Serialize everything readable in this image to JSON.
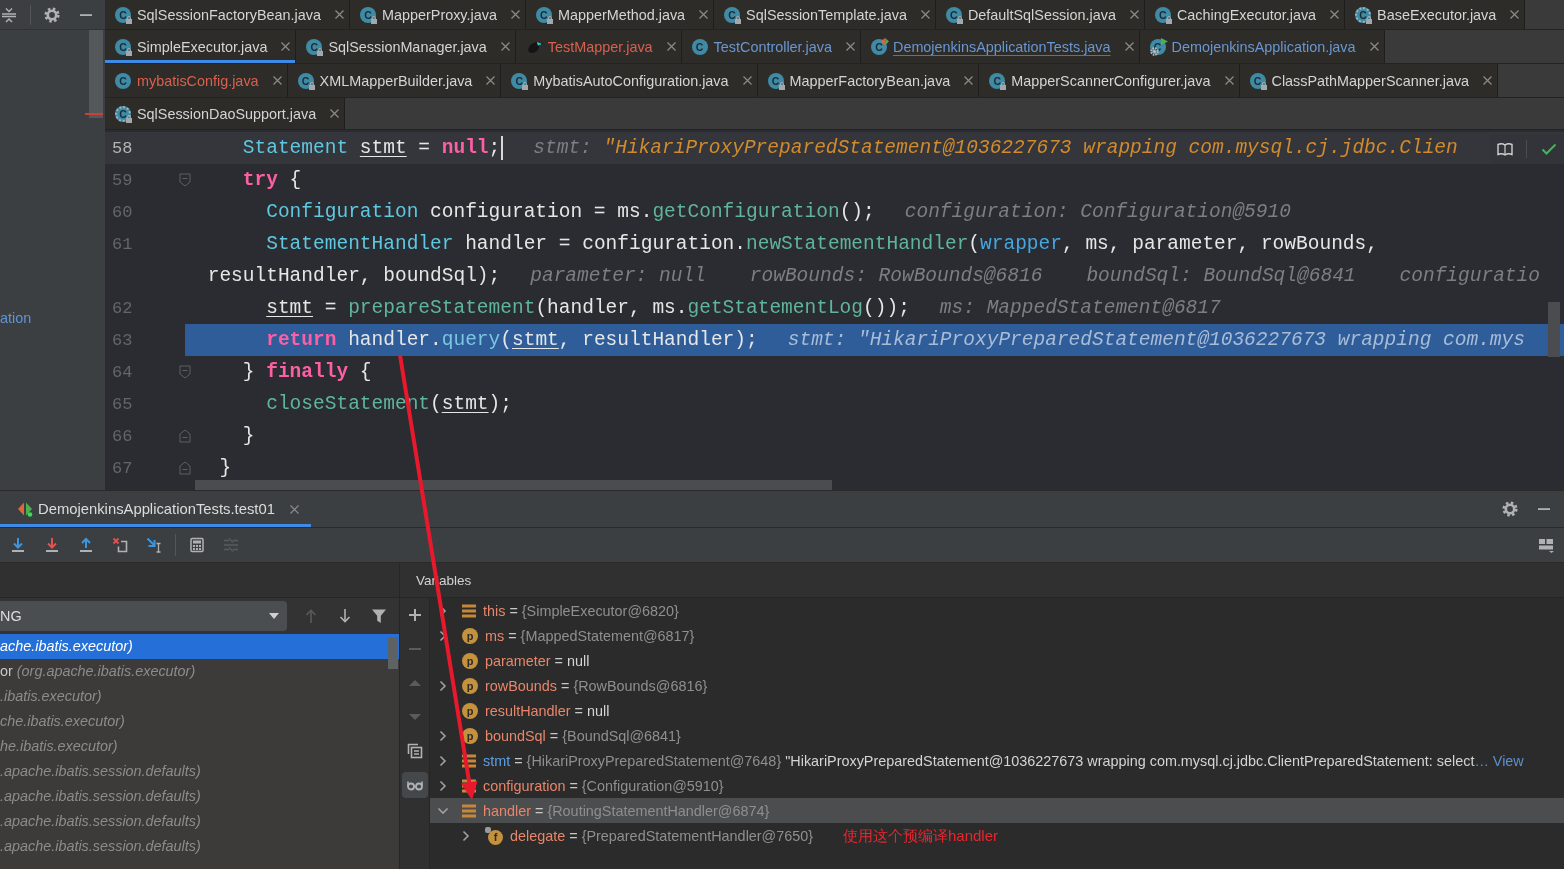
{
  "left_toolbar": [
    {
      "kind": "collapse"
    },
    {
      "kind": "settings"
    },
    {
      "kind": "minimize"
    }
  ],
  "project_panel": {
    "item": "ation"
  },
  "tab_rows": [
    [
      {
        "label": "SqlSessionFactoryBean.java",
        "kind": "class",
        "badge": "C",
        "locked": true,
        "color": "#d4d4d4",
        "selected": false,
        "errors": false
      },
      {
        "label": "MapperProxy.java",
        "kind": "class",
        "badge": "C",
        "locked": true,
        "color": "#d4d4d4",
        "selected": false,
        "errors": false
      },
      {
        "label": "MapperMethod.java",
        "kind": "class",
        "badge": "C",
        "locked": true,
        "color": "#d4d4d4",
        "selected": false,
        "errors": false
      },
      {
        "label": "SqlSessionTemplate.java",
        "kind": "class",
        "badge": "C",
        "locked": true,
        "color": "#d4d4d4",
        "selected": false,
        "errors": false
      },
      {
        "label": "DefaultSqlSession.java",
        "kind": "class",
        "badge": "C",
        "locked": true,
        "color": "#d4d4d4",
        "selected": false,
        "errors": false
      },
      {
        "label": "CachingExecutor.java",
        "kind": "class",
        "badge": "C",
        "locked": true,
        "color": "#d4d4d4",
        "selected": false,
        "errors": false
      },
      {
        "label": "BaseExecutor.java",
        "kind": "abstract",
        "badge": "C",
        "locked": true,
        "color": "#d4d4d4",
        "selected": false,
        "errors": false
      }
    ],
    [
      {
        "label": "SimpleExecutor.java",
        "kind": "class",
        "badge": "C",
        "locked": true,
        "color": "#d4d4d4",
        "selected": true,
        "errors": false
      },
      {
        "label": "SqlSessionManager.java",
        "kind": "class",
        "badge": "C",
        "locked": true,
        "color": "#d4d4d4",
        "selected": false,
        "errors": false
      },
      {
        "label": "TestMapper.java",
        "kind": "mapper",
        "locked": false,
        "color": "#d8604f",
        "selected": false,
        "errors": false
      },
      {
        "label": "TestController.java",
        "kind": "class",
        "badge": "C",
        "locked": false,
        "color": "#6897d2",
        "selected": false,
        "errors": false
      },
      {
        "label": "DemojenkinsApplicationTests.java",
        "kind": "test",
        "badge": "C",
        "locked": false,
        "color": "#6897d2",
        "selected": false,
        "errors": true
      },
      {
        "label": "DemojenkinsApplication.java",
        "kind": "app",
        "badge": "C",
        "locked": false,
        "color": "#6897d2",
        "selected": false,
        "errors": false
      }
    ],
    [
      {
        "label": "mybatisConfig.java",
        "kind": "class",
        "badge": "C",
        "locked": false,
        "color": "#d8604f",
        "selected": false,
        "errors": false
      },
      {
        "label": "XMLMapperBuilder.java",
        "kind": "class",
        "badge": "C",
        "locked": true,
        "color": "#d4d4d4",
        "selected": false,
        "errors": false
      },
      {
        "label": "MybatisAutoConfiguration.java",
        "kind": "class",
        "badge": "C",
        "locked": true,
        "color": "#d4d4d4",
        "selected": false,
        "errors": false
      },
      {
        "label": "MapperFactoryBean.java",
        "kind": "class",
        "badge": "C",
        "locked": true,
        "color": "#d4d4d4",
        "selected": false,
        "errors": false
      },
      {
        "label": "MapperScannerConfigurer.java",
        "kind": "class",
        "badge": "C",
        "locked": true,
        "color": "#d4d4d4",
        "selected": false,
        "errors": false
      },
      {
        "label": "ClassPathMapperScanner.java",
        "kind": "class",
        "badge": "C",
        "locked": true,
        "color": "#d4d4d4",
        "selected": false,
        "errors": false
      }
    ],
    [
      {
        "label": "SqlSessionDaoSupport.java",
        "kind": "abstract",
        "badge": "C",
        "locked": true,
        "color": "#d4d4d4",
        "selected": false,
        "errors": false
      }
    ]
  ],
  "editor": {
    "rows": [
      {
        "kind": "line",
        "number": "58",
        "caret": true,
        "selected": false,
        "code": [
          {
            "kind": "type",
            "text": "    Statement "
          },
          {
            "kind": "var",
            "text": "stmt"
          },
          {
            "kind": "plain",
            "text": " = "
          },
          {
            "kind": "keyword",
            "text": "null"
          },
          {
            "kind": "plain",
            "text": ";"
          }
        ],
        "hints": [
          {
            "kind": "string",
            "name": "stmt:",
            "value": "\"HikariProxyPreparedStatement@1036227673 wrapping com.mysql.cj.jdbc.Clien"
          }
        ]
      },
      {
        "kind": "block-start",
        "number": "59",
        "caret": false,
        "selected": false,
        "code": [
          {
            "kind": "keyword",
            "text": "    try"
          },
          {
            "kind": "plain",
            "text": " {"
          }
        ]
      },
      {
        "kind": "line",
        "number": "60",
        "caret": false,
        "selected": false,
        "code": [
          {
            "kind": "type",
            "text": "      Configuration"
          },
          {
            "kind": "plain",
            "text": " configuration = ms."
          },
          {
            "kind": "method",
            "text": "getConfiguration"
          },
          {
            "kind": "plain",
            "text": "();"
          }
        ],
        "hints": [
          {
            "kind": "object",
            "name": "configuration:",
            "value": "Configuration@5910"
          }
        ]
      },
      {
        "kind": "line",
        "number": "61",
        "caret": false,
        "selected": false,
        "code": [
          {
            "kind": "type",
            "text": "      StatementHandler"
          },
          {
            "kind": "plain",
            "text": " handler = configuration."
          },
          {
            "kind": "method",
            "text": "newStatementHandler"
          },
          {
            "kind": "plain",
            "text": "("
          },
          {
            "kind": "param",
            "text": "wrapper"
          },
          {
            "kind": "plain",
            "text": ", ms, parameter, rowBounds,"
          }
        ]
      },
      {
        "kind": "wrap",
        "caret": false,
        "selected": false,
        "code": [
          {
            "kind": "plain",
            "text": " resultHandler, boundSql);"
          }
        ],
        "hints": [
          {
            "kind": "object",
            "name": "parameter:",
            "value": "null"
          },
          {
            "kind": "object",
            "name": "rowBounds:",
            "value": "RowBounds@6816"
          },
          {
            "kind": "object",
            "name": "boundSql:",
            "value": "BoundSql@6841"
          },
          {
            "kind": "object",
            "name": "configuratio"
          }
        ]
      },
      {
        "kind": "line",
        "number": "62",
        "caret": false,
        "selected": false,
        "code": [
          {
            "kind": "var",
            "text": "      stmt"
          },
          {
            "kind": "plain",
            "text": " = "
          },
          {
            "kind": "method",
            "text": "prepareStatement"
          },
          {
            "kind": "plain",
            "text": "(handler, ms."
          },
          {
            "kind": "method",
            "text": "getStatementLog"
          },
          {
            "kind": "plain",
            "text": "());"
          }
        ],
        "hints": [
          {
            "kind": "object",
            "name": "ms:",
            "value": "MappedStatement@6817"
          }
        ]
      },
      {
        "kind": "line",
        "number": "63",
        "caret": false,
        "selected": true,
        "code": [
          {
            "kind": "keyword",
            "text": "      return"
          },
          {
            "kind": "plain",
            "text": " handler."
          },
          {
            "kind": "method",
            "text": "query"
          },
          {
            "kind": "plain",
            "text": "("
          },
          {
            "kind": "var",
            "text": "stmt"
          },
          {
            "kind": "plain",
            "text": ", resultHandler);"
          }
        ],
        "hints": [
          {
            "kind": "string",
            "name": "stmt:",
            "value": "\"HikariProxyPreparedStatement@1036227673 wrapping com.mys"
          }
        ]
      },
      {
        "kind": "block-start",
        "number": "64",
        "caret": false,
        "selected": false,
        "code": [
          {
            "kind": "plain",
            "text": "    } "
          },
          {
            "kind": "keyword",
            "text": "finally"
          },
          {
            "kind": "plain",
            "text": " {"
          }
        ]
      },
      {
        "kind": "line",
        "number": "65",
        "caret": false,
        "selected": false,
        "code": [
          {
            "kind": "method",
            "text": "      closeStatement"
          },
          {
            "kind": "plain",
            "text": "("
          },
          {
            "kind": "var",
            "text": "stmt"
          },
          {
            "kind": "plain",
            "text": ");"
          }
        ]
      },
      {
        "kind": "block-end",
        "number": "66",
        "caret": false,
        "selected": false,
        "code": [
          {
            "kind": "plain",
            "text": "    }"
          }
        ]
      },
      {
        "kind": "block-end",
        "number": "67",
        "caret": false,
        "selected": false,
        "code": [
          {
            "kind": "plain",
            "text": "  }"
          }
        ]
      }
    ],
    "actions": [
      {
        "kind": "reader-mode"
      },
      {
        "kind": "check"
      }
    ]
  },
  "debug": {
    "session_tab": {
      "label": "DemojenkinsApplicationTests.test01",
      "selected": true
    },
    "header_actions": [
      {
        "kind": "settings"
      },
      {
        "kind": "minimize"
      }
    ],
    "toolbar": [
      [
        {
          "kind": "step-over",
          "disabled": false
        },
        {
          "kind": "step-into",
          "disabled": false
        },
        {
          "kind": "step-out",
          "disabled": false
        },
        {
          "kind": "drop-frame",
          "disabled": false
        },
        {
          "kind": "run-to-cursor",
          "disabled": false
        }
      ],
      [
        {
          "kind": "evaluate",
          "disabled": false
        },
        {
          "kind": "trace",
          "disabled": true
        }
      ]
    ],
    "layout_action": {
      "kind": "layout"
    },
    "frames": {
      "thread": "NG",
      "nav": [
        {
          "kind": "up",
          "disabled": true
        },
        {
          "kind": "down",
          "disabled": false
        },
        {
          "kind": "filter",
          "disabled": false
        }
      ],
      "items": [
        {
          "location": "ache.ibatis.executor)",
          "selected": true
        },
        {
          "method": "or",
          "location": "(org.apache.ibatis.executor)",
          "selected": false
        },
        {
          "location": ".ibatis.executor)",
          "selected": false
        },
        {
          "location": "che.ibatis.executor)",
          "selected": false
        },
        {
          "location": "he.ibatis.executor)",
          "selected": false
        },
        {
          "location": ".apache.ibatis.session.defaults)",
          "selected": false
        },
        {
          "location": ".apache.ibatis.session.defaults)",
          "selected": false
        },
        {
          "location": ".apache.ibatis.session.defaults)",
          "selected": false
        },
        {
          "location": ".apache.ibatis.session.defaults)",
          "selected": false
        }
      ]
    },
    "variables": {
      "title": "Variables",
      "toolbar": [
        {
          "kind": "add",
          "disabled": false,
          "on": false
        },
        {
          "kind": "remove",
          "disabled": true,
          "on": false
        },
        {
          "kind": "move-up",
          "disabled": true,
          "on": false
        },
        {
          "kind": "move-down",
          "disabled": true,
          "on": false
        },
        {
          "kind": "copy",
          "disabled": false,
          "on": false
        },
        {
          "kind": "watches",
          "disabled": false,
          "on": true
        }
      ],
      "items": [
        {
          "name": "this",
          "kind": "stack",
          "assign": "=",
          "value": "{SimpleExecutor@6820}",
          "reference": true,
          "expandable": true,
          "expanded": false,
          "selected": false,
          "changed": false
        },
        {
          "name": "ms",
          "kind": "parameter",
          "badge": "p",
          "assign": "=",
          "value": "{MappedStatement@6817}",
          "reference": true,
          "expandable": true,
          "expanded": false,
          "selected": false,
          "changed": false
        },
        {
          "name": "parameter",
          "kind": "parameter",
          "badge": "p",
          "assign": "=",
          "value": "null",
          "reference": false,
          "expandable": false,
          "selected": false,
          "changed": false
        },
        {
          "name": "rowBounds",
          "kind": "parameter",
          "badge": "p",
          "assign": "=",
          "value": "{RowBounds@6816}",
          "reference": true,
          "expandable": true,
          "expanded": false,
          "selected": false,
          "changed": false
        },
        {
          "name": "resultHandler",
          "kind": "parameter",
          "badge": "p",
          "assign": "=",
          "value": "null",
          "reference": false,
          "expandable": false,
          "selected": false,
          "changed": false
        },
        {
          "name": "boundSql",
          "kind": "parameter",
          "badge": "p",
          "assign": "=",
          "value": "{BoundSql@6841}",
          "reference": true,
          "expandable": true,
          "expanded": false,
          "selected": false,
          "changed": false
        },
        {
          "name": "stmt",
          "kind": "stack",
          "assign": "=",
          "value": "{HikariProxyPreparedStatement@7648}",
          "reference": true,
          "text": "\"HikariProxyPreparedStatement@1036227673 wrapping com.mysql.cj.jdbc.ClientPreparedStatement: select",
          "link": "… View",
          "expandable": true,
          "expanded": false,
          "selected": false,
          "changed": true
        },
        {
          "name": "configuration",
          "kind": "stack",
          "assign": "=",
          "value": "{Configuration@5910}",
          "reference": true,
          "expandable": true,
          "expanded": false,
          "selected": false,
          "changed": false
        },
        {
          "name": "handler",
          "kind": "stack",
          "assign": "=",
          "value": "{RoutingStatementHandler@6874}",
          "reference": true,
          "expandable": true,
          "expanded": true,
          "selected": true,
          "changed": false,
          "children": [
            {
              "name": "delegate",
              "kind": "field",
              "badge": "f",
              "assign": "=",
              "value": "{PreparedStatementHandler@7650}",
              "reference": true,
              "expandable": true,
              "expanded": false,
              "selected": false,
              "changed": false
            }
          ]
        }
      ]
    }
  },
  "annotation": {
    "note": "使用这个预编译handler",
    "arrow": true
  }
}
